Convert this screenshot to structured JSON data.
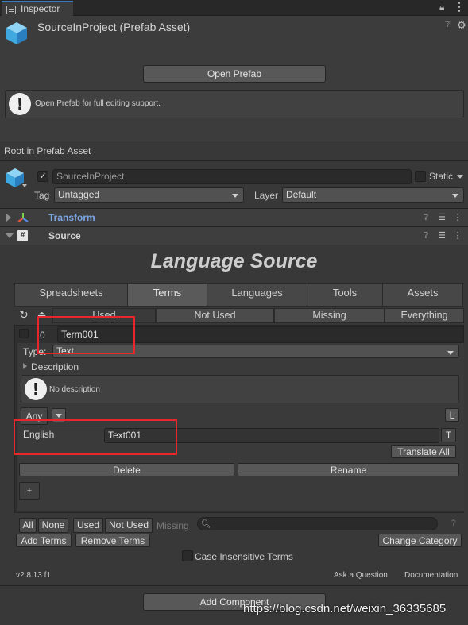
{
  "window": {
    "tab_label": "Inspector"
  },
  "asset": {
    "title": "SourceInProject (Prefab Asset)",
    "open_prefab": "Open Prefab",
    "help": "Open Prefab for full editing support.",
    "root_label": "Root in Prefab Asset"
  },
  "gameobject": {
    "name": "SourceInProject",
    "static_label": "Static",
    "tag_label": "Tag",
    "tag_value": "Untagged",
    "layer_label": "Layer",
    "layer_value": "Default"
  },
  "components": {
    "transform": "Transform",
    "source": "Source"
  },
  "language_source": {
    "title": "Language Source",
    "tabs": [
      "Spreadsheets",
      "Terms",
      "Languages",
      "Tools",
      "Assets"
    ],
    "filters": [
      "Used",
      "Not Used",
      "Missing",
      "Everything"
    ],
    "term_index": "0",
    "term_name": "Term001",
    "type_label": "Type:",
    "type_value": "Text",
    "description_label": "Description",
    "no_description": "No description",
    "any_label": "Any",
    "l_button": "L",
    "language": "English",
    "translation": "Text001",
    "t_button": "T",
    "translate_all": "Translate All",
    "delete": "Delete",
    "rename": "Rename",
    "plus": "+",
    "footer_filters": [
      "All",
      "None",
      "Used",
      "Not Used",
      "Missing"
    ],
    "add_terms": "Add Terms",
    "remove_terms": "Remove Terms",
    "change_category": "Change Category",
    "case_insensitive": "Case Insensitive Terms",
    "version": "v2.8.13 f1",
    "ask_question": "Ask a Question",
    "documentation": "Documentation"
  },
  "add_component": "Add Component",
  "watermark": "https://blog.csdn.net/weixin_36335685",
  "colors": {
    "accent": "#3a79bb",
    "transform_label": "#7aa7e6",
    "highlight_box": "#e8262c"
  }
}
